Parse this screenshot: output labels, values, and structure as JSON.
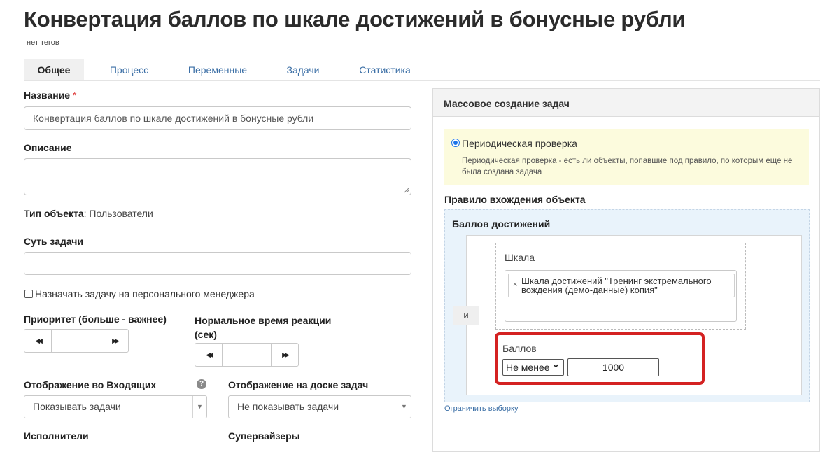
{
  "page": {
    "title": "Конвертация баллов по шкале достижений в бонусные рубли",
    "tags": "нет тегов"
  },
  "tabs": [
    {
      "label": "Общее",
      "active": true
    },
    {
      "label": "Процесс",
      "active": false
    },
    {
      "label": "Переменные",
      "active": false
    },
    {
      "label": "Задачи",
      "active": false
    },
    {
      "label": "Статистика",
      "active": false
    }
  ],
  "form": {
    "name_label": "Название",
    "required_mark": "*",
    "name_value": "Конвертация баллов по шкале достижений в бонусные рубли",
    "description_label": "Описание",
    "description_value": "",
    "object_type_label": "Тип объекта",
    "object_type_sep": ":",
    "object_type_value": "Пользователи",
    "essence_label": "Суть задачи",
    "essence_value": "",
    "assign_manager_label": "Назначать задачу на персонального менеджера",
    "assign_manager_checked": false,
    "priority_label": "Приоритет (больше - важнее)",
    "priority_value": "",
    "reaction_label_line1": "Нормальное время реакции",
    "reaction_label_line2": "(сек)",
    "reaction_value": "",
    "stepper_prev_icon": "◀◀",
    "stepper_next_icon": "▶▶",
    "inbox_display_label": "Отображение во Входящих",
    "inbox_display_value": "Показывать задачи",
    "board_display_label": "Отображение на доске задач",
    "board_display_value": "Не показывать задачи",
    "help_glyph": "?",
    "select_arrow": "▼",
    "executors_label": "Исполнители",
    "supervisors_label": "Супервайзеры"
  },
  "mass_panel": {
    "title": "Массовое создание задач",
    "option_label": "Периодическая проверка",
    "option_selected": true,
    "option_description": "Периодическая проверка - есть ли объекты, попавшие под правило, по которым еще не была создана задача",
    "rule_label": "Правило вхождения объекта",
    "rule_group_title": "Баллов достижений",
    "and_button": "и",
    "scale_label": "Шкала",
    "scale_chip_remove": "×",
    "scale_chip": "Шкала достижений \"Тренинг экстремального вождения (демо-данные) копия\"",
    "points_label": "Баллов",
    "points_operator": "Не менее",
    "points_operator_arrow": "⌄",
    "points_value": "1000",
    "limit_link": "Ограничить выборку"
  },
  "colors": {
    "link": "#3a6ea5",
    "highlight": "#d42222",
    "notice_bg": "#fcfbdd",
    "rule_bg": "#e9f3fb"
  }
}
